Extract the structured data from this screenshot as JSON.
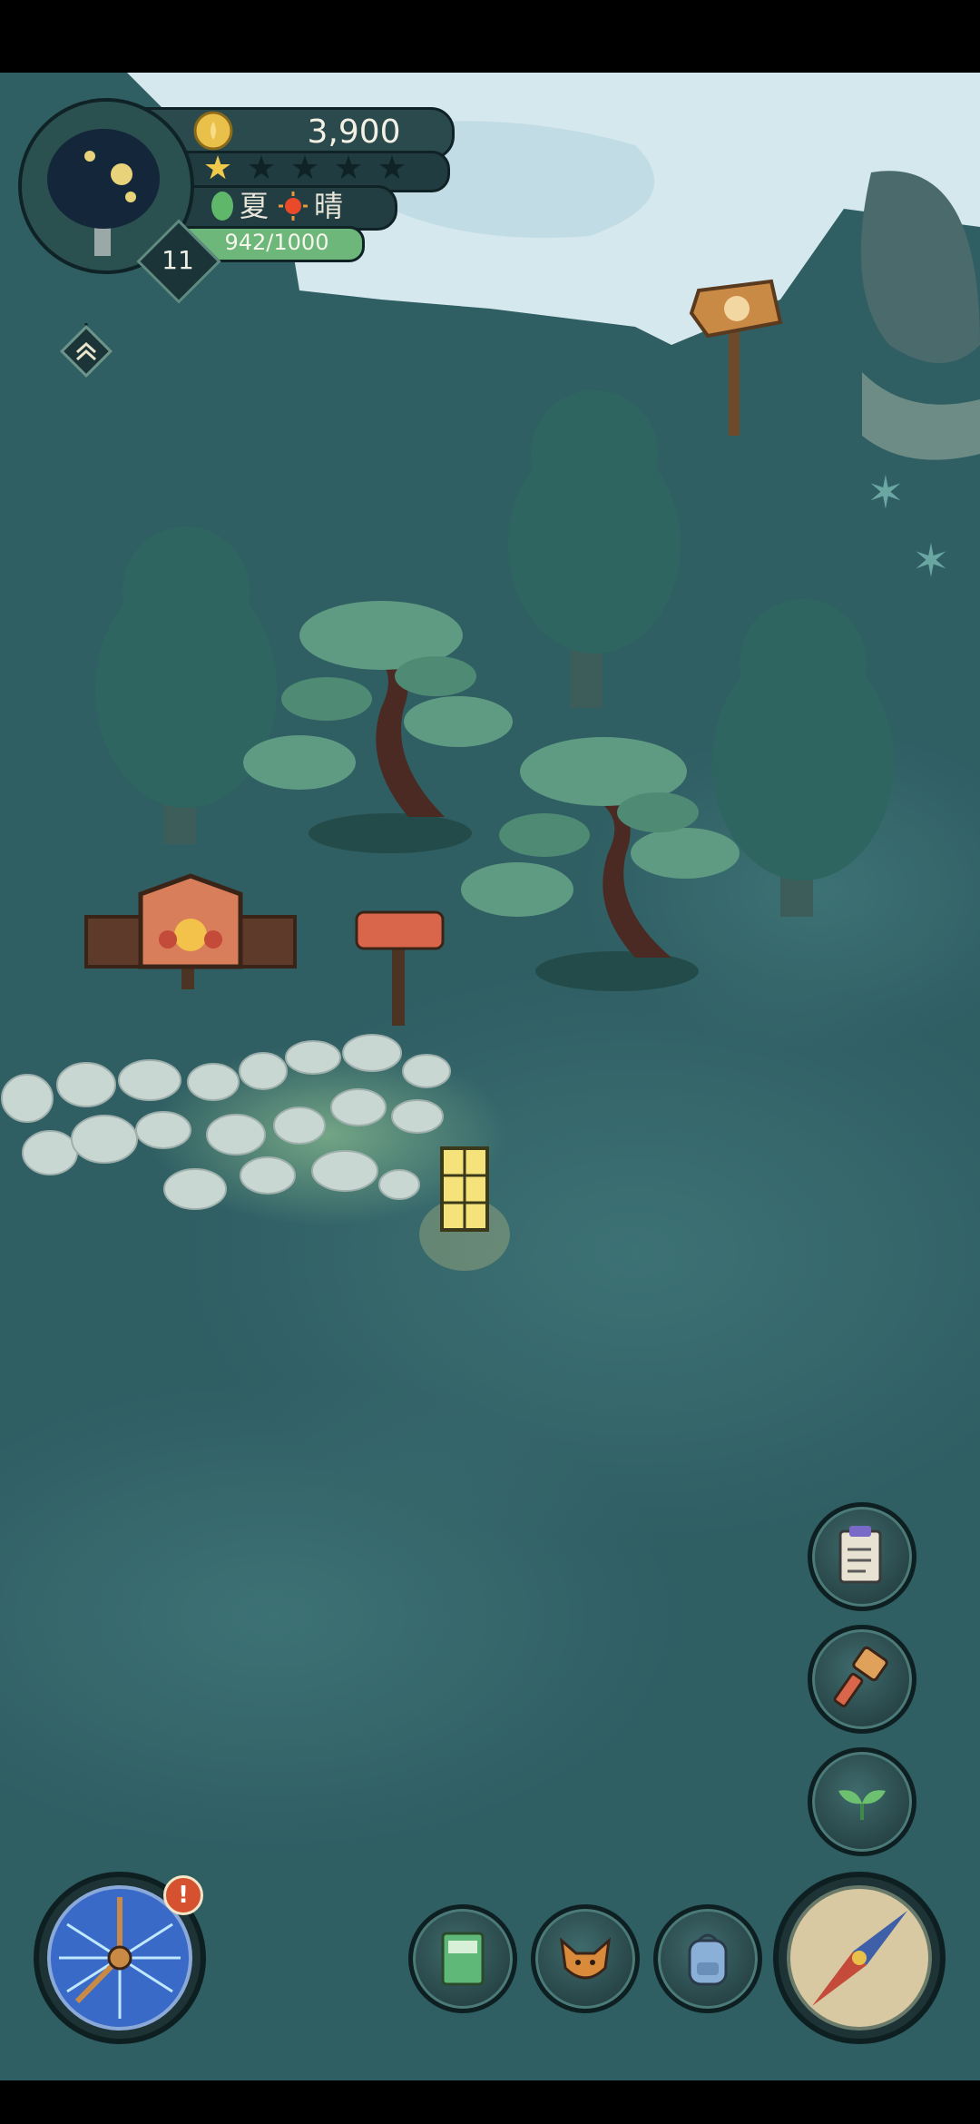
{
  "hud": {
    "coins": "3,900",
    "stars_filled": 1,
    "stars_total": 5,
    "season": "夏",
    "weather": "晴",
    "xp": "942/1000",
    "xp_fraction": 0.942,
    "level": "11",
    "alert_badge": "!"
  },
  "icons": {
    "coin": "coin-icon",
    "leaf": "leaf-icon",
    "sun": "sun-icon",
    "rank": "rank-up-icon",
    "tasks": "checklist-icon",
    "build": "hammer-icon",
    "plant": "sprout-icon",
    "book": "book-icon",
    "fox": "fox-icon",
    "bag": "backpack-icon",
    "compass": "compass-icon",
    "clock": "clock-icon"
  },
  "colors": {
    "water": "#2f5e63",
    "coin": "#e8c04a",
    "xp_bar": "#6db77a",
    "badge": "#d5512f"
  }
}
